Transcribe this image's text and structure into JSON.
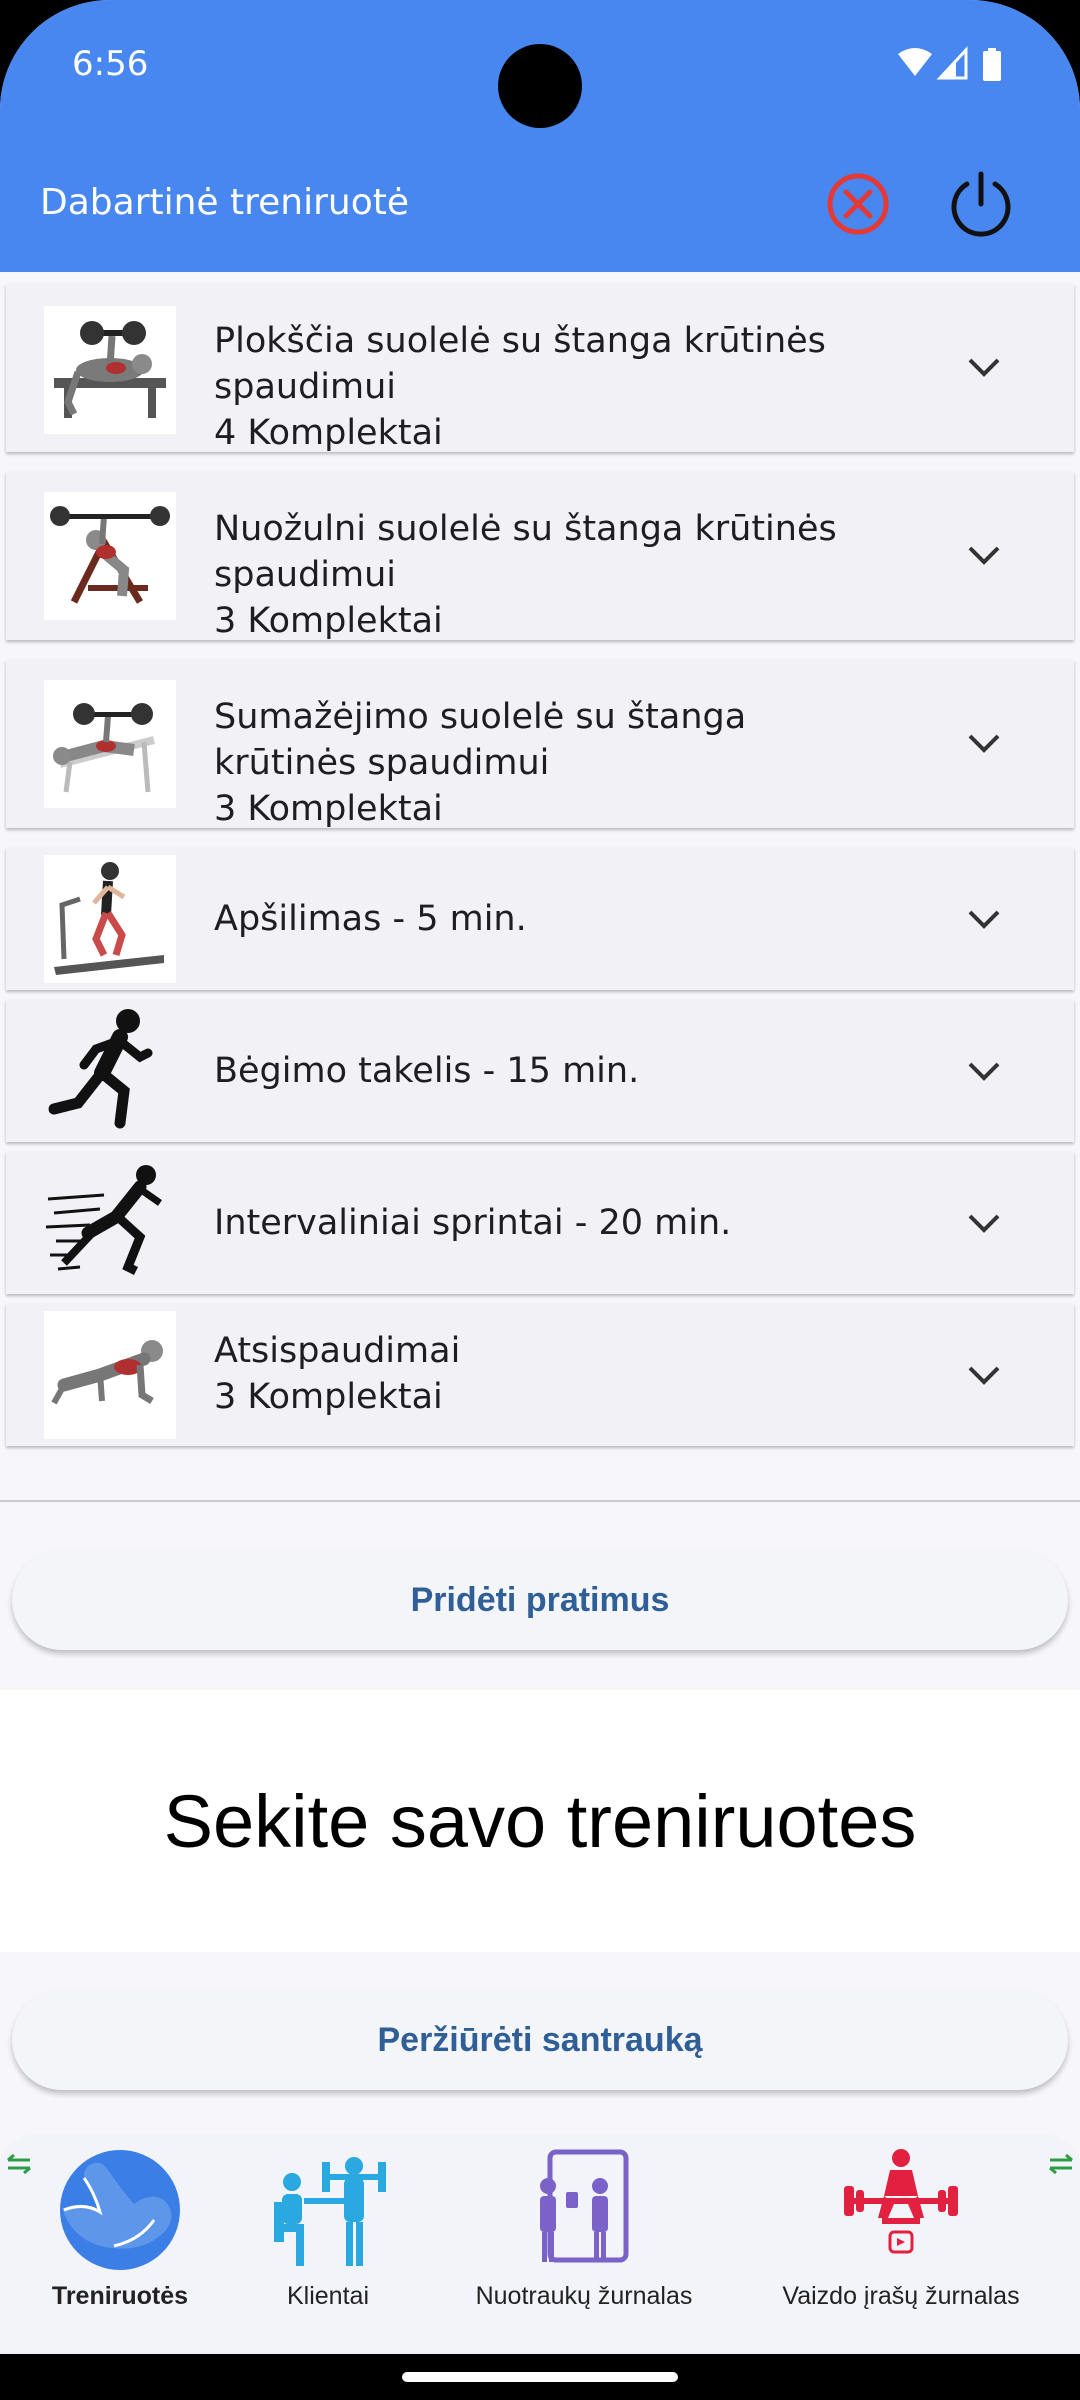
{
  "status": {
    "time": "6:56"
  },
  "app_bar": {
    "title": "Dabartinė treniruotė"
  },
  "exercises": [
    {
      "lines": [
        "Plokščia suolelė su štanga krūtinės",
        "spaudimui",
        "4 Komplektai"
      ]
    },
    {
      "lines": [
        "Nuožulni suolelė su štanga krūtinės",
        "spaudimui",
        "3 Komplektai"
      ]
    },
    {
      "lines": [
        "Sumažėjimo suolelė su štanga",
        "krūtinės spaudimui",
        "3 Komplektai"
      ]
    },
    {
      "lines": [
        "Apšilimas - 5 min."
      ]
    },
    {
      "lines": [
        "Bėgimo takelis - 15 min."
      ]
    },
    {
      "lines": [
        "Intervaliniai sprintai - 20 min."
      ]
    },
    {
      "lines": [
        "Atsispaudimai",
        "3 Komplektai"
      ]
    }
  ],
  "add_button": "Pridėti pratimus",
  "tagline": "Sekite savo treniruotes",
  "summary_button": "Peržiūrėti santrauką",
  "nav": {
    "items": [
      {
        "label": "Treniruotės",
        "active": true
      },
      {
        "label": "Klientai",
        "active": false
      },
      {
        "label": "Nuotraukų žurnalas",
        "active": false
      },
      {
        "label": "Vaizdo įrašų žurnalas",
        "active": false
      }
    ]
  },
  "colors": {
    "app_bar": "#4787ef",
    "button_text": "#2f5f96",
    "cancel_icon": "#e53935",
    "active_nav_icon": "#3b7fe6"
  }
}
